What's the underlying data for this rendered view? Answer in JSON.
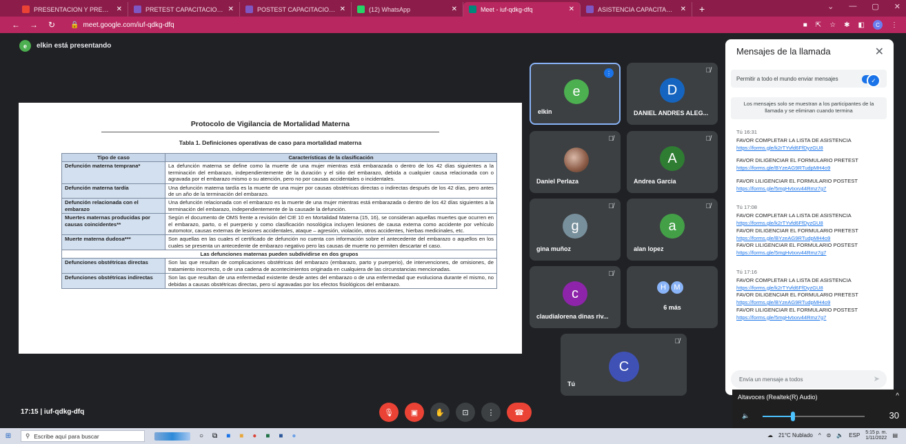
{
  "browser": {
    "tabs": [
      {
        "label": "PRESENTACION Y PREGUNTAS Y",
        "icon": "gmail-icon",
        "color": "#ea4335"
      },
      {
        "label": "PRETEST CAPACITACION Protoc",
        "icon": "forms-icon",
        "color": "#7e57c2"
      },
      {
        "label": "POSTEST CAPACITACION Protoc",
        "icon": "forms-icon",
        "color": "#7e57c2"
      },
      {
        "label": "(12) WhatsApp",
        "icon": "whatsapp-icon",
        "color": "#25d366"
      },
      {
        "label": "Meet - iuf-qdkg-dfq",
        "icon": "meet-icon",
        "color": "#00897b",
        "active": true
      },
      {
        "label": "ASISTENCIA CAPACITACION Prot",
        "icon": "forms-icon",
        "color": "#7e57c2"
      }
    ],
    "url": "meet.google.com/iuf-qdkg-dfq"
  },
  "meeting": {
    "presenter_initial": "e",
    "presenter_text": "elkin está presentando",
    "code": "17:15  |  iuf-qdkg-dfq"
  },
  "document": {
    "title": "Protocolo de Vigilancia de Mortalidad Materna",
    "table_title": "Tabla 1. Definiciones operativas de caso para mortalidad materna",
    "col1": "Tipo de caso",
    "col2": "Características de la clasificación",
    "rows": [
      {
        "type": "Defunción materna temprana*",
        "desc": "La defunción materna se define como la muerte de una mujer mientras está embarazada o dentro de los 42 días siguientes a la terminación del embarazo, independientemente de la duración y el sitio del embarazo, debida a cualquier causa relacionada con o agravada por el embarazo mismo o su atención, pero no por causas accidentales o incidentales."
      },
      {
        "type": "Defunción materna tardía",
        "desc": "Una defunción materna tardía es la muerte de una mujer por causas obstétricas directas o indirectas después de los 42 días, pero antes de un año de la terminación del embarazo."
      },
      {
        "type": "Defunción relacionada con el embarazo",
        "desc": "Una defunción relacionada con el embarazo es la muerte de una mujer mientras está embarazada o dentro de los 42 días siguientes a la terminación del embarazo, independientemente de la causade la defunción."
      },
      {
        "type": "Muertes maternas producidas por causas coincidentes**",
        "desc": "Según el documento de OMS frente a revisión del CIE 10 en Mortalidad Materna (15, 16), se consideran aquellas muertes que ocurren en el embarazo, parto, o el puerperio y como clasificación nosológica incluyen lesiones de causa externa como accidente por vehículo automotor, causas externas de lesiones accidentales, ataque – agresión, violación, otros accidentes, hierbas medicinales, etc."
      },
      {
        "type": "Muerte materna dudosa***",
        "desc": "Son aquellas en las cuales el certificado de defunción no cuenta con información sobre el antecedente del embarazo o aquellos en los cuales se presenta un antecedente de embarazo negativo pero las causas de muerte no permiten descartar el caso."
      }
    ],
    "subheader": "Las defunciones maternas pueden subdividirse en dos grupos",
    "rows2": [
      {
        "type": "Defunciones obstétricas directas",
        "desc": "Son las que resultan de complicaciones obstétricas del embarazo (embarazo, parto y puerperio), de intervenciones, de omisiones, de tratamiento incorrecto, o de una cadena de acontecimientos originada en cualquiera de las circunstancias mencionadas."
      },
      {
        "type": "Defunciones obstétricas indirectas",
        "desc": "Son las que resultan de una enfermedad existente desde antes del embarazo o de una enfermedad que evoluciona durante el mismo, no debidas a causas obstétricas directas, pero sí agravadas por los efectos fisiológicos del embarazo."
      }
    ]
  },
  "participants": [
    {
      "name": "elkin",
      "initial": "e",
      "color": "#4caf50",
      "speaking": true
    },
    {
      "name": "DANIEL ANDRES ALEG...",
      "initial": "D",
      "color": "#1565c0"
    },
    {
      "name": "Daniel Perlaza",
      "photo": true
    },
    {
      "name": "Andrea Garcia",
      "initial": "A",
      "color": "#2e7d32"
    },
    {
      "name": "gina muñoz",
      "initial": "g",
      "color": "#78909c"
    },
    {
      "name": "alan lopez",
      "initial": "a",
      "color": "#43a047"
    },
    {
      "name": "claudialorena dinas riv...",
      "initial": "c",
      "color": "#8e24aa"
    },
    {
      "name": "6 más",
      "initials": [
        "H",
        "M"
      ]
    },
    {
      "name": "Tú",
      "initial": "C",
      "color": "#3f51b5"
    }
  ],
  "chat": {
    "title": "Mensajes de la llamada",
    "allow_label": "Permitir a todo el mundo enviar mensajes",
    "notice": "Los mensajes solo se muestran a los participantes de la llamada y se eliminan cuando termina",
    "groups": [
      {
        "sender": "Tú",
        "time": "16:31",
        "wide": true,
        "messages": [
          {
            "text": "FAVOR COMPLETAR LA LISTA DE ASISTENCIA",
            "link": "https://forms.gle/k2rTYvfd6FfDyzGU8"
          },
          {
            "text": "FAVOR DILIGENCIAR EL FORMULARIO PRETEST",
            "link": "https://forms.gle/BYzeAG9RTudpMH4o9"
          },
          {
            "text": "FAVOR LILIGENCIAR EL FORMULARIO POSTEST",
            "link": "https://forms.gle/5mgHvtxxv44Rmz7g7"
          }
        ]
      },
      {
        "sender": "Tú",
        "time": "17:08",
        "messages": [
          {
            "text": "FAVOR COMPLETAR LA LISTA DE ASISTENCIA",
            "link": "https://forms.gle/k2rTYvfd6FfDyzGU8"
          },
          {
            "text": "FAVOR DILIGENCIAR EL FORMULARIO PRETEST",
            "link": "https://forms.gle/BYzeAG9RTudpMH4o9"
          },
          {
            "text": "FAVOR LILIGENCIAR EL FORMULARIO POSTEST",
            "link": "https://forms.gle/5mgHvtxxv44Rmz7g7"
          }
        ]
      },
      {
        "sender": "Tú",
        "time": "17:16",
        "messages": [
          {
            "text": "FAVOR COMPLETAR LA LISTA DE ASISTENCIA",
            "link": "https://forms.gle/k2rTYvfd6FfDyzGU8"
          },
          {
            "text": "FAVOR DILIGENCIAR EL FORMULARIO PRETEST",
            "link": "https://forms.gle/BYzeAG9RTudpMH4o9"
          },
          {
            "text": "FAVOR LILIGENCIAR EL FORMULARIO POSTEST",
            "link": "https://forms.gle/5mgHvtxxv44Rmz7g7"
          }
        ]
      }
    ],
    "input_placeholder": "Envía un mensaje a todos"
  },
  "audio": {
    "device": "Altavoces (Realtek(R) Audio)",
    "volume": 30,
    "volume_display": "30"
  },
  "taskbar": {
    "search_placeholder": "Escribe aquí para buscar",
    "weather": "21°C  Nublado",
    "lang": "ESP",
    "time": "5:15 p. m.",
    "date": "1/11/2022"
  }
}
